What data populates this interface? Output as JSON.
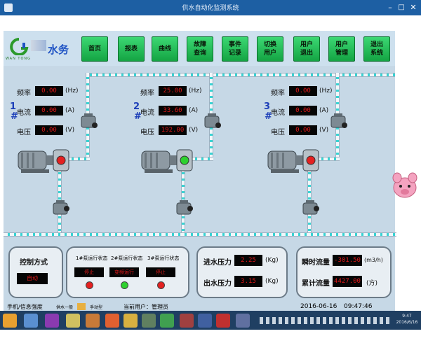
{
  "window": {
    "title": "供水自动化监测系统",
    "min_symbol": "–",
    "max_symbol": "□",
    "close_symbol": "✕"
  },
  "logo": {
    "brand": "水务",
    "subtitle": "WAN  TONG"
  },
  "nav": [
    {
      "label": "首页"
    },
    {
      "label": "报表"
    },
    {
      "label": "曲线"
    },
    {
      "label": "故障\n查询"
    },
    {
      "label": "事件\n记录"
    },
    {
      "label": "切换\n用户"
    },
    {
      "label": "用户\n退出"
    },
    {
      "label": "用户\n管理"
    },
    {
      "label": "退出\n系统"
    }
  ],
  "pumps": [
    {
      "number": "1",
      "hash": "#",
      "freq_label": "频率",
      "freq": "0.00",
      "freq_unit": "(Hz)",
      "current_label": "电流",
      "current": "0.00",
      "current_unit": "(A)",
      "voltage_label": "电压",
      "voltage": "0.00",
      "voltage_unit": "(V)",
      "status": "stopped",
      "status_color": "#e42020"
    },
    {
      "number": "2",
      "hash": "#",
      "freq_label": "频率",
      "freq": "25.00",
      "freq_unit": "(Hz)",
      "current_label": "电流",
      "current": "33.60",
      "current_unit": "(A)",
      "voltage_label": "电压",
      "voltage": "192.00",
      "voltage_unit": "(V)",
      "status": "running",
      "status_color": "#2ed12e"
    },
    {
      "number": "3",
      "hash": "#",
      "freq_label": "频率",
      "freq": "0.00",
      "freq_unit": "(Hz)",
      "current_label": "电流",
      "current": "0.00",
      "current_unit": "(A)",
      "voltage_label": "电压",
      "voltage": "0.00",
      "voltage_unit": "(V)",
      "status": "stopped",
      "status_color": "#e42020"
    }
  ],
  "control": {
    "title": "控制方式",
    "value": "自动"
  },
  "pump_status": {
    "items": [
      {
        "label": "1#泵运行状态",
        "value": "停止",
        "lamp": "#e42020"
      },
      {
        "label": "2#泵运行状态",
        "value": "变频运行",
        "lamp": "#2ed12e"
      },
      {
        "label": "3#泵运行状态",
        "value": "停止",
        "lamp": "#e42020"
      }
    ]
  },
  "pressure": {
    "inlet_label": "进水压力",
    "inlet": "2.25",
    "inlet_unit": "(Kg)",
    "outlet_label": "出水压力",
    "outlet": "3.15",
    "outlet_unit": "(Kg)"
  },
  "flow": {
    "instant_label": "瞬时流量",
    "instant": "-301.50",
    "instant_unit": "(m3/h)",
    "total_label": "累计流量",
    "total": "4427.00",
    "total_unit": "(方)"
  },
  "statusbar": {
    "left": "手机/信息强度",
    "mid1": "供水一般",
    "mid2": "手动型",
    "user_label": "当前用户：",
    "user": "管理员",
    "date": "2016-06-16",
    "time": "09:47:46"
  },
  "tray": {
    "time": "9:47",
    "date": "2016/6/16"
  },
  "colors": {
    "header_bg": "#cde0ee",
    "process_bg": "#c6d8e6",
    "nav_green": "#1fbf55",
    "pipe_stripe": "#38d3d3",
    "value_red": "#e11919",
    "value_bg": "#050505"
  }
}
